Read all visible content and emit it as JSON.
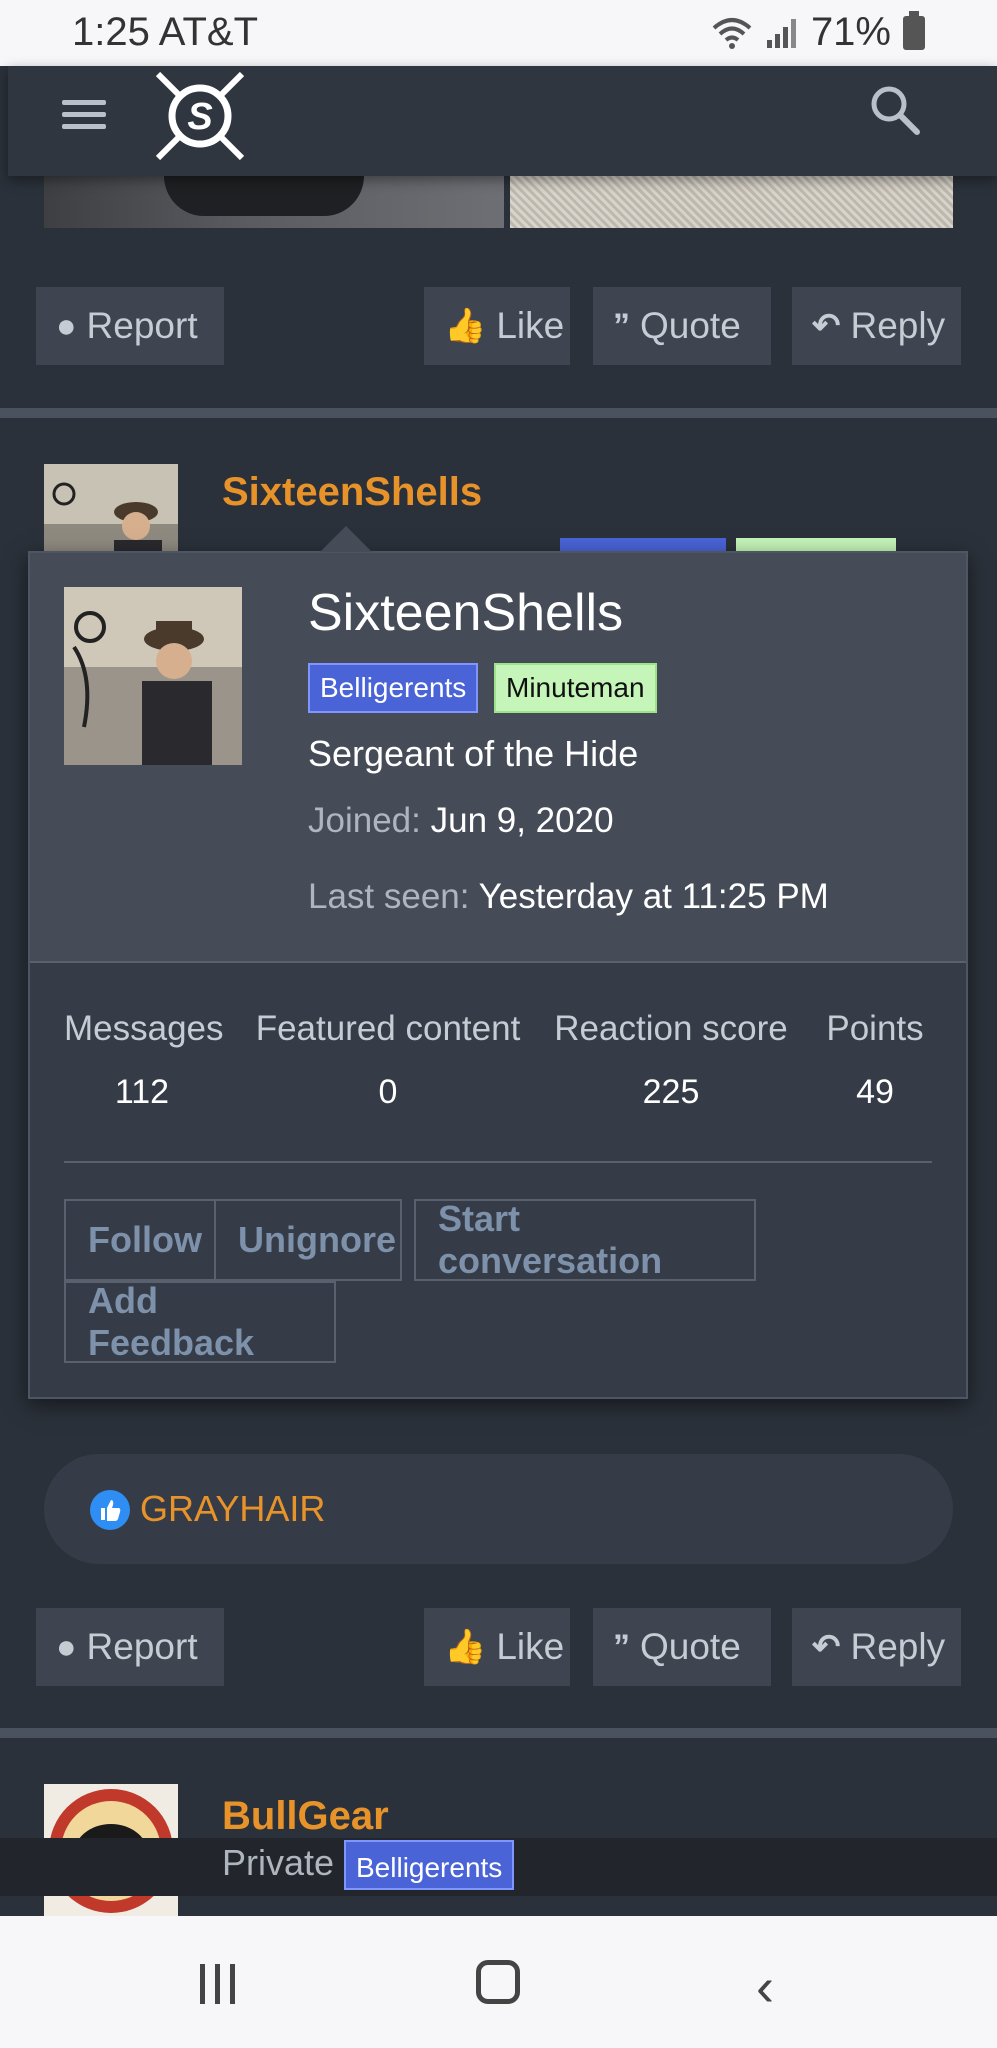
{
  "status_bar": {
    "time": "1:25",
    "carrier": "AT&T",
    "battery": "71%"
  },
  "actions": {
    "report": "Report",
    "like": "Like",
    "quote": "Quote",
    "reply": "Reply"
  },
  "post1": {
    "username": "SixteenShells"
  },
  "popup": {
    "name": "SixteenShells",
    "badges": [
      "Belligerents",
      "Minuteman"
    ],
    "title": "Sergeant of the Hide",
    "joined_label": "Joined:",
    "joined_value": "Jun 9, 2020",
    "lastseen_label": "Last seen:",
    "lastseen_value": "Yesterday at 11:25 PM",
    "stats": [
      {
        "label": "Messages",
        "value": "112"
      },
      {
        "label": "Featured content",
        "value": "0"
      },
      {
        "label": "Reaction score",
        "value": "225"
      },
      {
        "label": "Points",
        "value": "49"
      }
    ],
    "buttons": {
      "follow": "Follow",
      "unignore": "Unignore",
      "start_conversation": "Start conversation",
      "add_feedback": "Add Feedback"
    }
  },
  "reaction": {
    "user": "GRAYHAIR"
  },
  "post2": {
    "username": "BullGear",
    "title": "Private",
    "badge": "Belligerents"
  },
  "colors": {
    "accent_orange": "#e8932a",
    "badge_blue": "#4a64d8",
    "badge_green": "#c5f5b8"
  }
}
